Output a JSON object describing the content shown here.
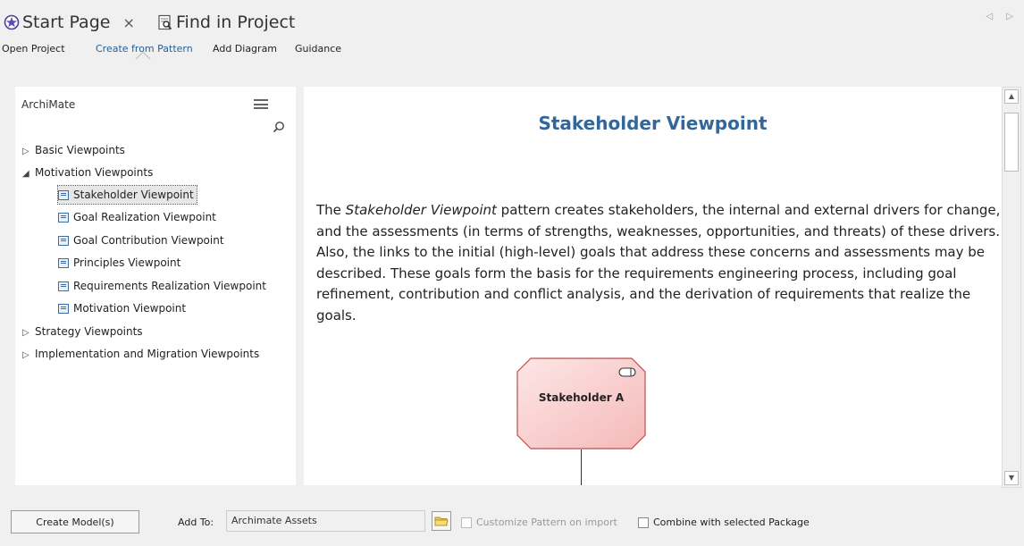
{
  "tabs": [
    {
      "label": "Start Page",
      "icon": "start-page-icon",
      "closable": true,
      "active": true
    },
    {
      "label": "Find in Project",
      "icon": "find-in-project-icon",
      "closable": false,
      "active": false
    }
  ],
  "subnav": {
    "items": [
      "Open Project",
      "Create from Pattern",
      "Add Diagram",
      "Guidance"
    ],
    "active": "Create from Pattern"
  },
  "left_panel": {
    "title": "ArchiMate",
    "tree": [
      {
        "label": "Basic Viewpoints",
        "expanded": false
      },
      {
        "label": "Motivation Viewpoints",
        "expanded": true
      },
      {
        "label": "Stakeholder Viewpoint",
        "selected": true
      },
      {
        "label": "Goal Realization Viewpoint"
      },
      {
        "label": "Goal Contribution Viewpoint"
      },
      {
        "label": "Principles Viewpoint"
      },
      {
        "label": "Requirements Realization Viewpoint"
      },
      {
        "label": "Motivation Viewpoint"
      },
      {
        "label": "Strategy Viewpoints",
        "expanded": false
      },
      {
        "label": "Implementation and Migration Viewpoints",
        "expanded": false
      }
    ]
  },
  "content": {
    "title": "Stakeholder Viewpoint",
    "body_em": "Stakeholder Viewpoint",
    "body_pre": "The ",
    "body_post": " pattern creates stakeholders, the internal and external drivers for change, and the assessments (in terms of strengths, weaknesses, opportunities, and threats) of these drivers. Also, the links to the initial (high-level) goals that address these concerns and assessments may be described. These goals form the basis for the requirements engineering process, including goal refinement, contribution and conflict analysis, and the derivation of requirements that realize the goals.",
    "diagram_element": "Stakeholder A"
  },
  "bottom": {
    "create_button": "Create Model(s)",
    "add_to_label": "Add To:",
    "add_to_value": "Archimate Assets",
    "customize_checkbox": {
      "label": "Customize Pattern on import",
      "checked": false,
      "enabled": false
    },
    "combine_checkbox": {
      "label": "Combine with selected Package",
      "checked": false,
      "enabled": true
    }
  },
  "colors": {
    "title_blue": "#336699",
    "active_link": "#2a5d8f",
    "stakeholder_fill": "#f9d0d0",
    "stakeholder_stroke": "#c06060"
  }
}
